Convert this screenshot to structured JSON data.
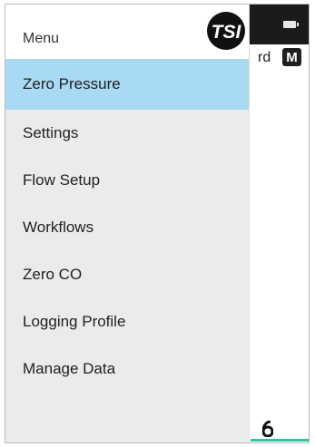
{
  "background": {
    "row_text": "rd",
    "mode_badge": "M",
    "bottom_glyph": "6"
  },
  "drawer": {
    "title": "Menu",
    "logo_text": "TSI",
    "items": [
      {
        "label": "Zero Pressure",
        "active": true
      },
      {
        "label": "Settings"
      },
      {
        "label": "Flow Setup"
      },
      {
        "label": "Workflows"
      },
      {
        "label": "Zero CO"
      },
      {
        "label": "Logging Profile"
      },
      {
        "label": "Manage Data"
      }
    ]
  },
  "colors": {
    "active_item": "#a9daf3",
    "drawer_bg": "#ebebeb",
    "accent": "#2fc7a0"
  }
}
